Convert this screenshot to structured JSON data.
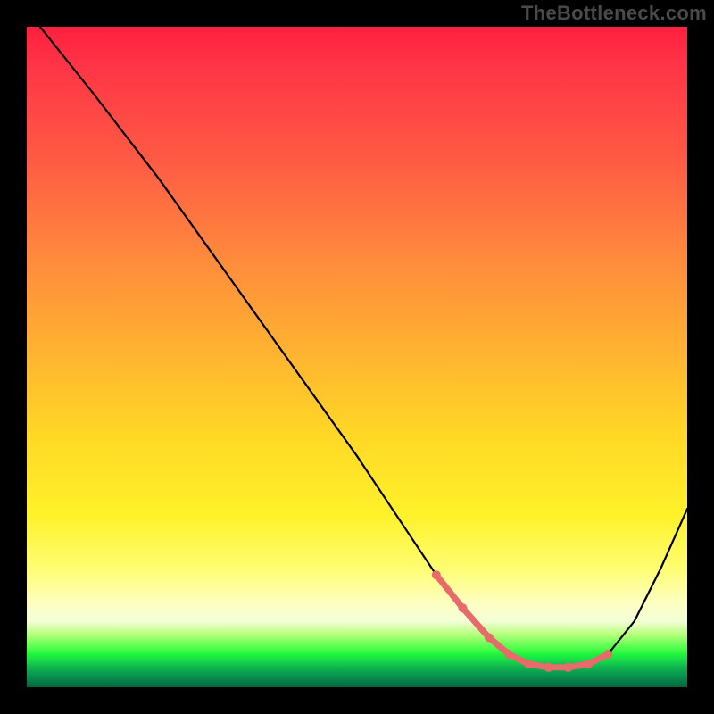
{
  "watermark": "TheBottleneck.com",
  "chart_data": {
    "type": "line",
    "title": "",
    "xlabel": "",
    "ylabel": "",
    "xlim": [
      0,
      100
    ],
    "ylim": [
      0,
      100
    ],
    "grid": false,
    "legend": false,
    "series": [
      {
        "name": "bottleneck-curve",
        "x": [
          2,
          10,
          20,
          30,
          40,
          50,
          58,
          62,
          66,
          70,
          73,
          76,
          79,
          82,
          85,
          88,
          92,
          96,
          100
        ],
        "y": [
          100,
          90,
          77,
          63,
          49,
          35,
          23,
          17,
          12,
          7.5,
          5,
          3.5,
          3,
          3,
          3.5,
          5,
          10,
          18,
          27
        ]
      }
    ],
    "highlighted_range": {
      "name": "optimal-range",
      "x": [
        62,
        66,
        70,
        73,
        76,
        79,
        82,
        85,
        88
      ],
      "y": [
        17,
        12,
        7.5,
        5,
        3.5,
        3,
        3,
        3.5,
        5
      ]
    },
    "gradient_bands": [
      {
        "name": "red",
        "from": 100,
        "to": 45
      },
      {
        "name": "orange",
        "from": 45,
        "to": 20
      },
      {
        "name": "yellow",
        "from": 20,
        "to": 10
      },
      {
        "name": "green",
        "from": 10,
        "to": 0
      }
    ]
  },
  "colors": {
    "curve": "#000000",
    "highlight": "#e86a6a",
    "background": "#000000"
  }
}
